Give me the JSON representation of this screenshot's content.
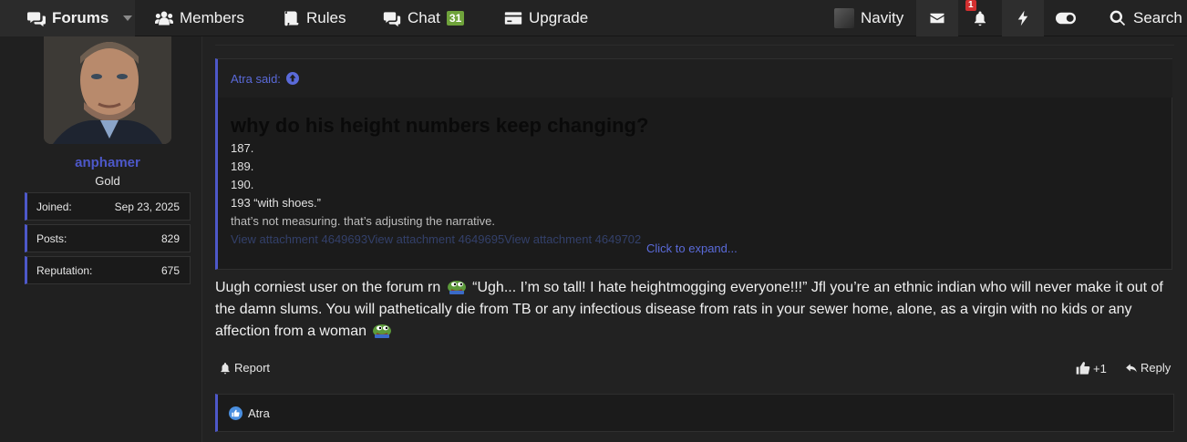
{
  "nav": {
    "forums": "Forums",
    "members": "Members",
    "rules": "Rules",
    "chat": "Chat",
    "chat_count": "31",
    "upgrade": "Upgrade",
    "username": "Navity",
    "alerts_count": "1",
    "search": "Search"
  },
  "user": {
    "name": "anphamer",
    "rank": "Gold",
    "stats": [
      {
        "label": "Joined:",
        "value": "Sep 23, 2025"
      },
      {
        "label": "Posts:",
        "value": "829"
      },
      {
        "label": "Reputation:",
        "value": "675"
      }
    ]
  },
  "quote": {
    "author": "Atra said:",
    "title": "why do his height numbers keep changing?",
    "lines": [
      "187.",
      "189.",
      "190.",
      "193 “with shoes.”"
    ],
    "fade_line": "that’s not measuring. that’s adjusting the narrative.",
    "attachments": "View attachment 4649693View attachment 4649695View attachment 4649702",
    "expand": "Click to expand..."
  },
  "post": {
    "text_1": "Uugh corniest user on the forum rn",
    "text_2": "“Ugh... I’m so tall! I hate heightmogging everyone!!!” Jfl you’re an ethnic indian who will never make it out of the damn slums. You will pathetically die from TB or any infectious disease from rats in your sewer home, alone, as a virgin with no kids or any affection from a woman"
  },
  "actions": {
    "report": "Report",
    "like": "+1",
    "reply": "Reply"
  },
  "reactions": {
    "user": "Atra"
  },
  "colors": {
    "accent": "#4d58c9",
    "link": "#5a6ad9",
    "badge": "#6fa33b",
    "alert": "#d32f2f"
  }
}
